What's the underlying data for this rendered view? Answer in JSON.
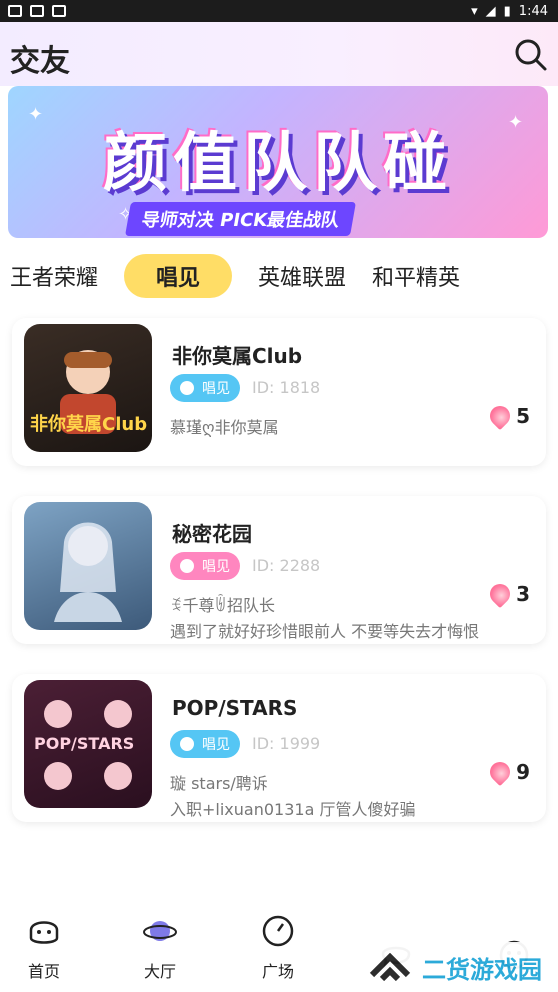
{
  "status_bar": {
    "time": "1:44"
  },
  "header": {
    "title": "交友"
  },
  "banner": {
    "title": "颜值队队碰",
    "subtitle": "导师对决 PICK最佳战队"
  },
  "tabs": [
    {
      "label": "王者荣耀"
    },
    {
      "label": "唱见"
    },
    {
      "label": "英雄联盟"
    },
    {
      "label": "和平精英"
    }
  ],
  "rooms": [
    {
      "name": "非你莫属Club",
      "badge": "唱见",
      "id": "ID: 1818",
      "desc1": "慕瑾ღ非你莫属",
      "desc2": "",
      "count": "5",
      "colors": {
        "badge": "#55c6f4"
      }
    },
    {
      "name": "秘密花园",
      "badge": "唱见",
      "id": "ID: 2288",
      "desc1": "ꉂ千尊ꉄ招队长",
      "desc2": "遇到了就好好珍惜眼前人 不要等失去才悔恨",
      "count": "3",
      "colors": {
        "badge": "#ff86bf"
      }
    },
    {
      "name": "POP/STARS",
      "badge": "唱见",
      "id": "ID: 1999",
      "desc1": "璇 stars/聘诉",
      "desc2": "入职+lixuan0131a 厅管人傻好骗",
      "count": "9",
      "colors": {
        "badge": "#55c6f4"
      }
    }
  ],
  "thumbs": {
    "t0_text": "非你莫属Club",
    "t2_text": "POP/STARS"
  },
  "nav": [
    {
      "label": "首页"
    },
    {
      "label": "大厅"
    },
    {
      "label": "广场"
    }
  ],
  "watermark": {
    "text": "二货游戏园"
  }
}
